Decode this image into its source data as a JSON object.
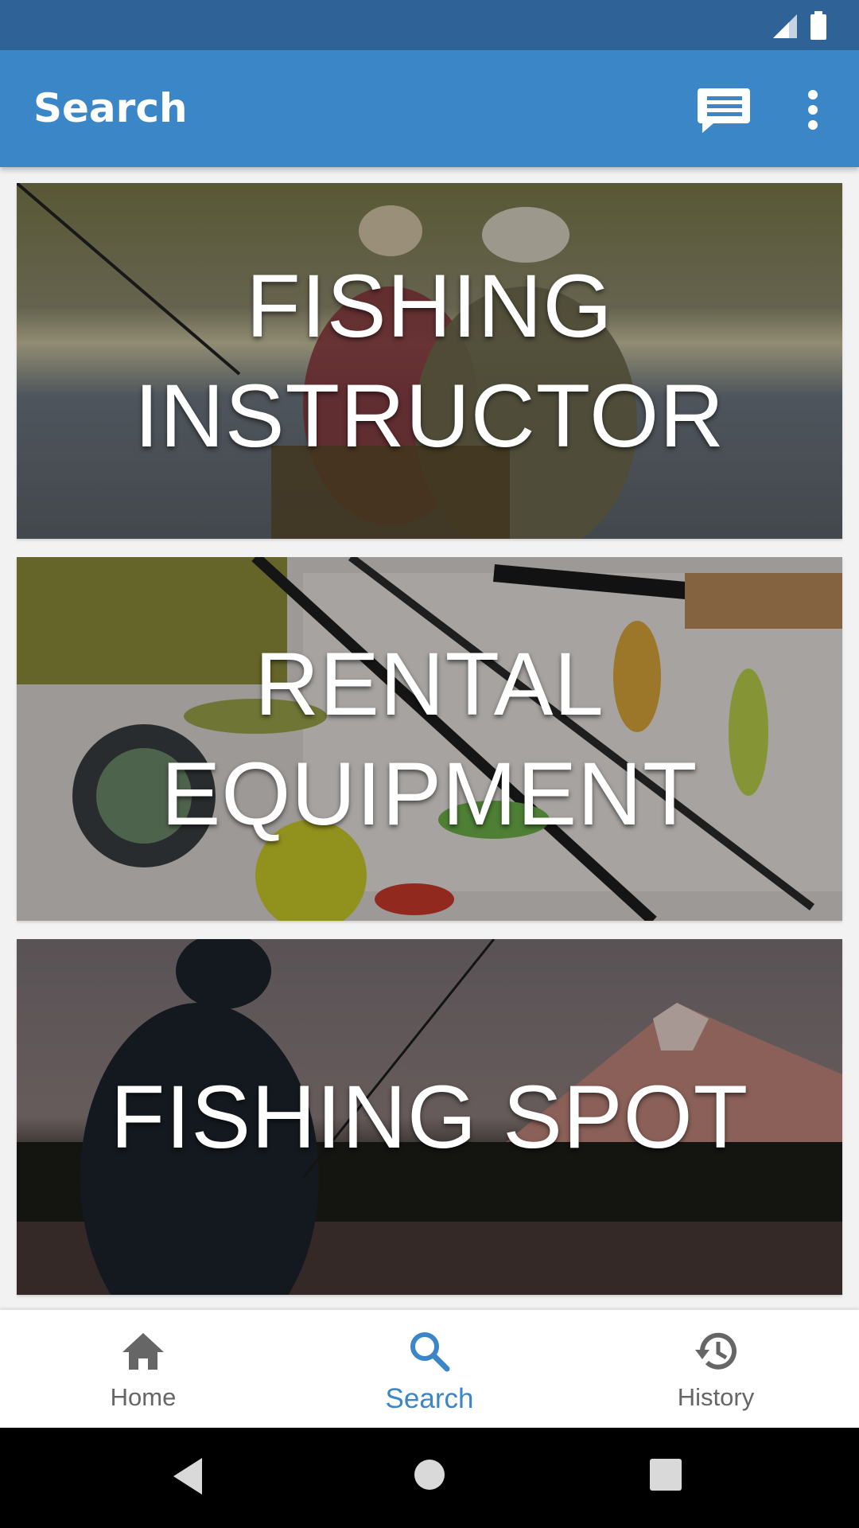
{
  "status_bar": {
    "icons": [
      "signal-icon",
      "battery-icon"
    ],
    "color": "#2f6397"
  },
  "app_bar": {
    "title": "Search",
    "color": "#3b86c7",
    "actions": [
      "chat-icon",
      "more-vert-icon"
    ]
  },
  "cards": [
    {
      "title": "FISHING\nINSTRUCTOR",
      "image": "two people fly fishing by a river"
    },
    {
      "title": "RENTAL\nEQUIPMENT",
      "image": "fishing reels, rods and lures in tackle box"
    },
    {
      "title": "FISHING SPOT",
      "image": "silhouette of angler at lake with snowy mountain"
    }
  ],
  "bottom_nav": {
    "items": [
      {
        "label": "Home",
        "icon": "home-icon",
        "active": false
      },
      {
        "label": "Search",
        "icon": "search-icon",
        "active": true
      },
      {
        "label": "History",
        "icon": "history-icon",
        "active": false
      }
    ],
    "active_color": "#3b86c7",
    "inactive_color": "#666666"
  },
  "system_nav": {
    "buttons": [
      "back-icon",
      "home-circle-icon",
      "recents-icon"
    ]
  }
}
